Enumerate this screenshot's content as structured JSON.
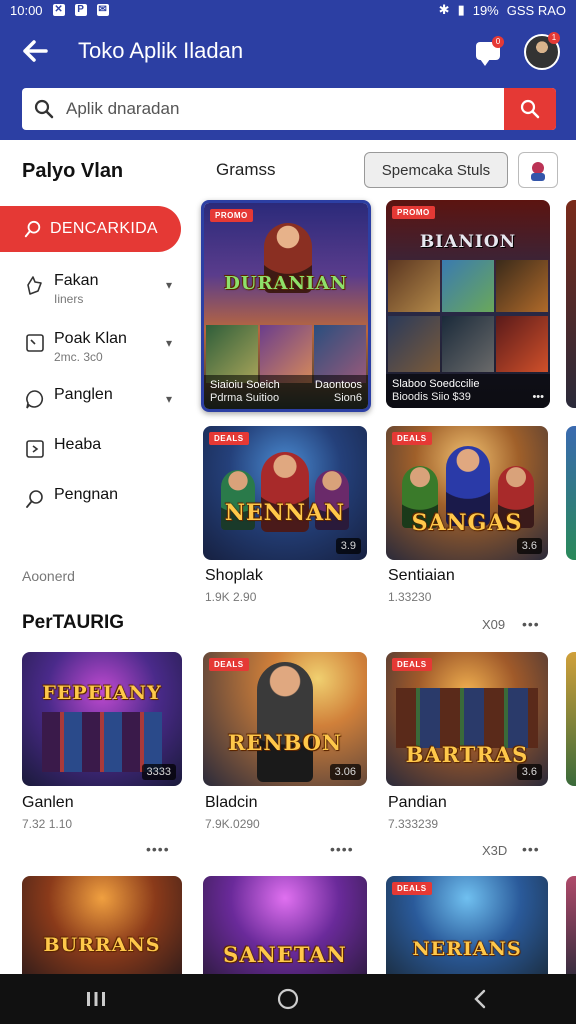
{
  "status_bar": {
    "left_text": "10:00",
    "battery": "19%",
    "right_text": "GSS RAO"
  },
  "header": {
    "title": "Toko Aplik Iladan",
    "chat_badge": "0",
    "avatar_badge": "1"
  },
  "search": {
    "placeholder": "Aplik dnaradan"
  },
  "sidebar": {
    "title": "Palyo Vlan",
    "cta_label": "DENCARKIDA",
    "items": [
      {
        "label": "Fakan",
        "sub": "Iiners"
      },
      {
        "label": "Poak Klan",
        "sub": "2mc. 3c0"
      },
      {
        "label": "Panglen",
        "sub": ""
      },
      {
        "label": "Heaba",
        "sub": ""
      },
      {
        "label": "Pengnan",
        "sub": ""
      }
    ],
    "footer": "Aoonerd"
  },
  "top_row": {
    "tab_label": "Gramss",
    "filter_label": "Spemcaka Stuls"
  },
  "featured": [
    {
      "badge": "PROMO",
      "art_title": "DURANIAN",
      "meta_1": "Siaioiu Soeich",
      "meta_2": "Pdrma Suitioo",
      "meta_right_1": "Daontoos",
      "meta_right_2": "Sion6"
    },
    {
      "badge": "PROMO",
      "art_title": "BIANION",
      "meta_1": "Slaboo Soedccilie",
      "meta_2": "Bioodis Siio $39",
      "meta_right_1": "",
      "meta_right_2": "•••"
    }
  ],
  "grid_row1": [
    {
      "badge": "DEALS",
      "art_title": "NENNAN",
      "rating": "3.9",
      "label": "Shoplak",
      "sub": "1.9K 2.90"
    },
    {
      "badge": "DEALS",
      "art_title": "SANGAS",
      "rating": "3.6",
      "label": "Sentiaian",
      "sub": "1.33230"
    }
  ],
  "section": {
    "title": "PerTAURIG",
    "more": "X09",
    "more_dots": "•••"
  },
  "grid_row2": [
    {
      "badge": "",
      "art_title": "FEPEIANY",
      "rating": "3333",
      "label": "Ganlen",
      "sub": "7.32 1.10",
      "dots": "••••"
    },
    {
      "badge": "DEALS",
      "art_title": "RENBON",
      "rating": "3.06",
      "label": "Bladcin",
      "sub": "7.9K.0290",
      "dots": "••••"
    },
    {
      "badge": "DEALS",
      "art_title": "BARTRAS",
      "rating": "3.6",
      "label": "Pandian",
      "sub": "7.333239",
      "dots": "•••",
      "extra": "X3D"
    }
  ],
  "grid_row3": [
    {
      "badge": "",
      "art_title": "BURRANS"
    },
    {
      "badge": "",
      "art_title": "SANETAN"
    },
    {
      "badge": "DEALS",
      "art_title": "NERIANS"
    }
  ],
  "colors": {
    "primary": "#2c3fa3",
    "accent": "#e53935"
  }
}
